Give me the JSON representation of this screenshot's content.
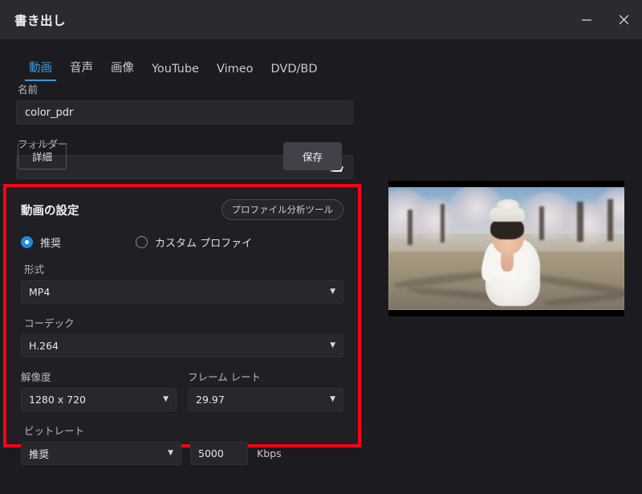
{
  "window": {
    "title": "書き出し",
    "minimize_label": "最小化",
    "close_label": "閉じる"
  },
  "tabs": [
    {
      "label": "動画",
      "active": true
    },
    {
      "label": "音声",
      "active": false
    },
    {
      "label": "画像",
      "active": false
    },
    {
      "label": "YouTube",
      "active": false
    },
    {
      "label": "Vimeo",
      "active": false
    },
    {
      "label": "DVD/BD",
      "active": false
    }
  ],
  "name_field": {
    "label": "名前",
    "value": "color_pdr",
    "placeholder": ""
  },
  "folder_field": {
    "label": "フォルダー",
    "value": "",
    "placeholder": "",
    "icon": "folder-open-icon"
  },
  "settings": {
    "section_title": "動画の設定",
    "analyze_button": "プロファイル分析ツール",
    "profile_mode": {
      "recommended": {
        "label": "推奨",
        "selected": true
      },
      "custom": {
        "label": "カスタム プロファイ",
        "selected": false
      }
    },
    "format": {
      "label": "形式",
      "value": "MP4"
    },
    "codec": {
      "label": "コーデック",
      "value": "H.264"
    },
    "resolution": {
      "label": "解像度",
      "value": "1280 x 720"
    },
    "framerate": {
      "label": "フレーム レート",
      "value": "29.97"
    },
    "bitrate": {
      "label": "ビットレート",
      "mode": "推奨",
      "value": "5000",
      "unit": "Kbps"
    },
    "highlight_color": "#ff0016"
  },
  "footer": {
    "detail_button": "詳細",
    "save_button": "保存"
  },
  "preview": {
    "name": "video-preview",
    "description": ""
  },
  "colors": {
    "accent": "#3b9ae1",
    "titlebar": "#2a2a2f",
    "background": "#1c1c20",
    "field": "#27272c",
    "highlight": "#ff0016"
  }
}
